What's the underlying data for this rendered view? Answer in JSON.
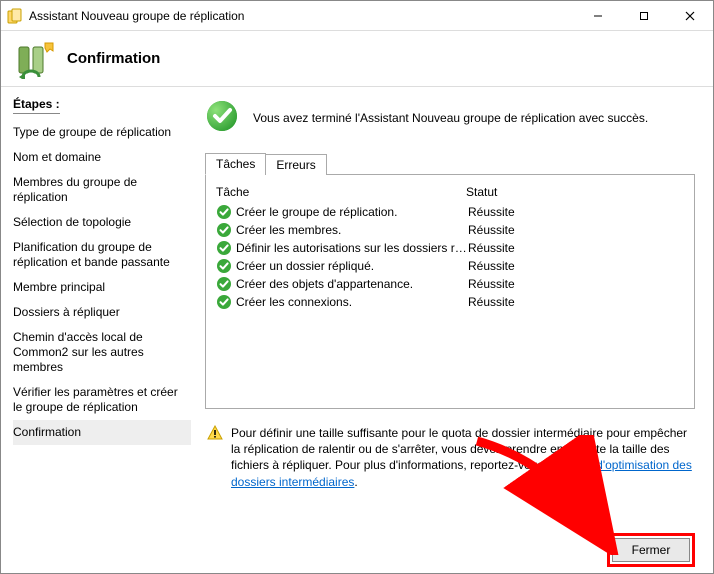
{
  "window": {
    "title": "Assistant Nouveau groupe de réplication"
  },
  "header": {
    "title": "Confirmation"
  },
  "sidebar": {
    "heading": "Étapes :",
    "steps": [
      "Type de groupe de réplication",
      "Nom et domaine",
      "Membres du groupe de réplication",
      "Sélection de topologie",
      "Planification du groupe de réplication et bande passante",
      "Membre principal",
      "Dossiers à répliquer",
      "Chemin d'accès local de Common2 sur les autres membres",
      "Vérifier les paramètres et créer le groupe de réplication",
      "Confirmation"
    ],
    "active_index": 9
  },
  "content": {
    "success_message": "Vous avez terminé l'Assistant Nouveau groupe de réplication avec succès.",
    "tabs": [
      {
        "label": "Tâches"
      },
      {
        "label": "Erreurs"
      }
    ],
    "active_tab": 0,
    "columns": {
      "task": "Tâche",
      "status": "Statut"
    },
    "rows": [
      {
        "task": "Créer le groupe de réplication.",
        "status": "Réussite"
      },
      {
        "task": "Créer les membres.",
        "status": "Réussite"
      },
      {
        "task": "Définir les autorisations sur les dossiers répliqu...",
        "status": "Réussite"
      },
      {
        "task": "Créer un dossier répliqué.",
        "status": "Réussite"
      },
      {
        "task": "Créer des objets d'appartenance.",
        "status": "Réussite"
      },
      {
        "task": "Créer les connexions.",
        "status": "Réussite"
      }
    ],
    "info": {
      "text_before_link": "Pour définir une taille suffisante pour le quota de dossier intermédiaire pour empêcher la réplication de ralentir ou de s'arrêter, vous devez prendre en compte la taille des fichiers à répliquer. Pour plus d'informations, reportez-vous au ",
      "link_text": "guide d'optimisation des dossiers intermédiaires",
      "text_after_link": "."
    }
  },
  "footer": {
    "close_label": "Fermer"
  }
}
